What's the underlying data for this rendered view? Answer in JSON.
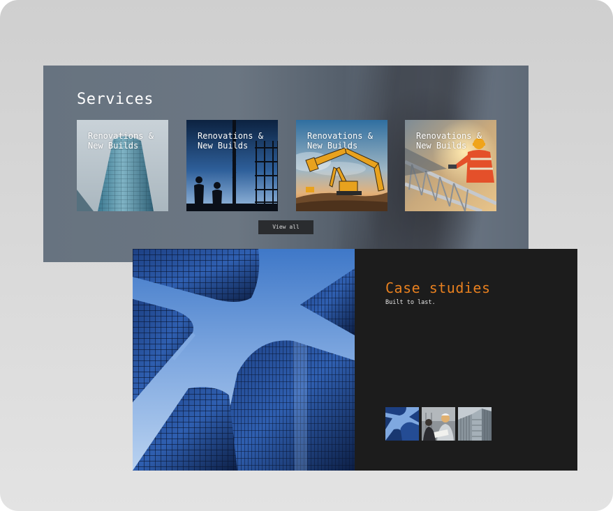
{
  "services": {
    "title": "Services",
    "cards": [
      {
        "label": "Renovations & New Builds",
        "image": "glass-tower-photo"
      },
      {
        "label": "Renovations & New Builds",
        "image": "silhouette-workers-photo"
      },
      {
        "label": "Renovations & New Builds",
        "image": "excavator-photo"
      },
      {
        "label": "Renovations & New Builds",
        "image": "roof-worker-photo"
      }
    ],
    "view_all_label": "View all"
  },
  "case_studies": {
    "title": "Case studies",
    "subtitle": "Built to last.",
    "main_image": "skyscrapers-looking-up-photo",
    "thumbnails": [
      {
        "image": "skyscrapers-thumbnail"
      },
      {
        "image": "engineers-thumbnail"
      },
      {
        "image": "building-facade-thumbnail"
      }
    ]
  },
  "colors": {
    "accent": "#e8801f",
    "dark_panel": "#1c1c1c",
    "services_panel": "#67737f",
    "button_bg": "#2a2c2f"
  }
}
